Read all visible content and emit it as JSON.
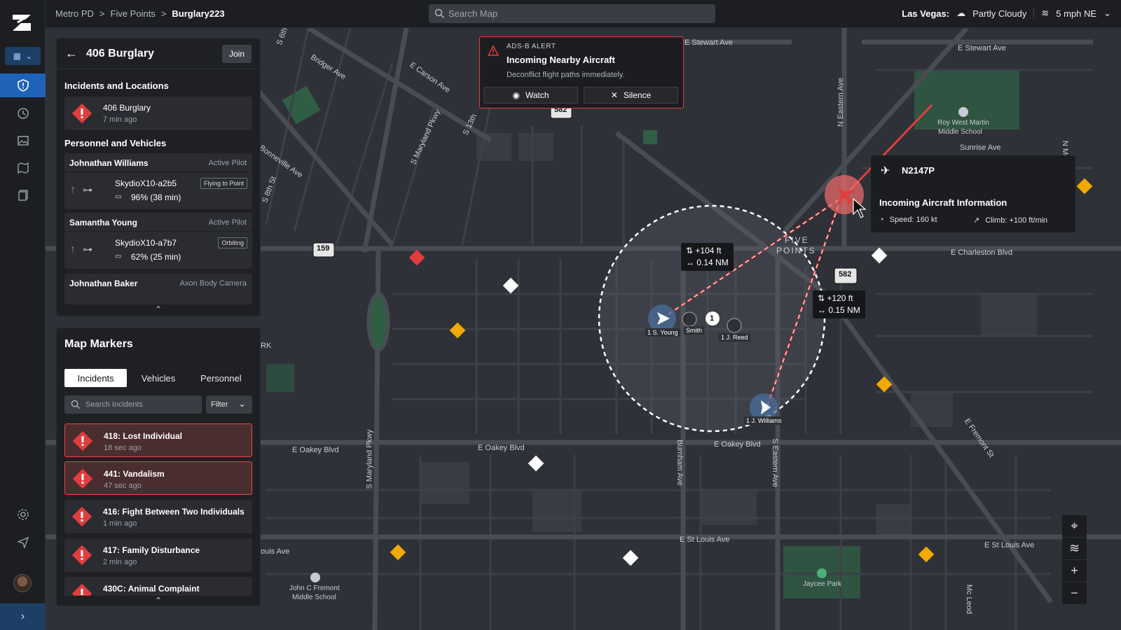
{
  "breadcrumb": {
    "items": [
      "Metro PD",
      "Five Points"
    ],
    "current": "Burglary223",
    "separator": ">"
  },
  "search": {
    "placeholder": "Search Map"
  },
  "weather": {
    "city": "Las Vegas:",
    "condition": "Partly Cloudy",
    "wind": "5 mph NE"
  },
  "incident_panel": {
    "title": "406 Burglary",
    "join_label": "Join",
    "incidents_section": "Incidents and Locations",
    "incident": {
      "title": "406 Burglary",
      "time": "7 min ago"
    },
    "personnel_section": "Personnel and Vehicles",
    "personnel": [
      {
        "name": "Johnathan Williams",
        "role": "Active Pilot",
        "vehicle": "SkydioX10-a2b5",
        "status": "Flying to Point",
        "battery": "96% (38 min)"
      },
      {
        "name": "Samantha Young",
        "role": "Active Pilot",
        "vehicle": "SkydioX10-a7b7",
        "status": "Orbiting",
        "battery": "62% (25 min)"
      },
      {
        "name": "Johnathan Baker",
        "role": "Axon Body Camera"
      }
    ]
  },
  "markers_panel": {
    "title": "Map Markers",
    "tabs": [
      "Incidents",
      "Vehicles",
      "Personnel"
    ],
    "search_placeholder": "Search Incidents",
    "filter_label": "Filter",
    "incidents": [
      {
        "title": "418: Lost Individual",
        "time": "18 sec ago"
      },
      {
        "title": "441: Vandalism",
        "time": "47 sec ago"
      },
      {
        "title": "416: Fight Between Two Individuals at...",
        "time": "1 min ago"
      },
      {
        "title": "417: Family Disturbance",
        "time": "2 min ago"
      },
      {
        "title": "430C: Animal Complaint",
        "time": ""
      }
    ]
  },
  "adsb_alert": {
    "label": "ADS-B ALERT",
    "heading": "Incoming Nearby Aircraft",
    "message": "Deconflict flight paths immediately.",
    "watch_label": "Watch",
    "silence_label": "Silence"
  },
  "aircraft": {
    "id": "N2147P",
    "title": "Incoming Aircraft Information",
    "speed": "Speed: 160 kt",
    "climb": "Climb: +100 ft/min"
  },
  "distance_boxes": [
    {
      "alt": "+104 ft",
      "dist": "0.14 NM"
    },
    {
      "alt": "+120 ft",
      "dist": "0.15 NM"
    }
  ],
  "units": {
    "young": "1 S. Young",
    "smith": "Smith",
    "reed": "1 J. Reed",
    "williams": "1 J. Williams",
    "cluster_count": "1"
  },
  "map_labels": {
    "e_stewart_ave_1": "E Stewart Ave",
    "e_stewart_ave_2": "E Stewart Ave",
    "e_carson_ave": "E Carson Ave",
    "bridger_ave": "Bridger Ave",
    "s_13th": "S 13th",
    "s_maryland_pkwy": "S Maryland Pkwy",
    "bonneville_ave": "Bonneville Ave",
    "s_8th_st": "S 8th St",
    "n_eastern_ave": "N Eastern Ave",
    "sunrise_ave": "Sunrise Ave",
    "roy_west_martin": "Roy West Martin",
    "middle_school": "Middle School",
    "e_charleston_blvd": "E Charleston Blvd",
    "five": "FIVE",
    "points": "POINTS",
    "e_oakey_blvd_1": "E Oakey Blvd",
    "e_oakey_blvd_2": "E Oakey Blvd",
    "e_oakey_blvd_3": "E Oakey Blvd",
    "s_maryland_pkwy_2": "S Maryland Pkwy",
    "burnham_ave": "Burnham Ave",
    "s_eastern_ave": "S Eastern Ave",
    "e_st_louis_ave_1": "E St Louis Ave",
    "e_st_louis_ave_2": "E St Louis Ave",
    "ouis_ave": "ouis Ave",
    "john_c_fremont": "John C Fremont",
    "middle_school_2": "Middle School",
    "jaycee_park": "Jaycee Park",
    "e_fremont_st": "E Fremont St",
    "mc_leod": "Mc Leod",
    "n_mojave": "N Mojav",
    "rk": "RK",
    "s_6th": "S 6th",
    "highway_159": "159",
    "highway_582_a": "582",
    "highway_582_b": "582"
  },
  "colors": {
    "accent": "#1e63b8",
    "alert": "#e23d3d",
    "warning": "#f2a900",
    "map_bg": "#2f3138"
  }
}
